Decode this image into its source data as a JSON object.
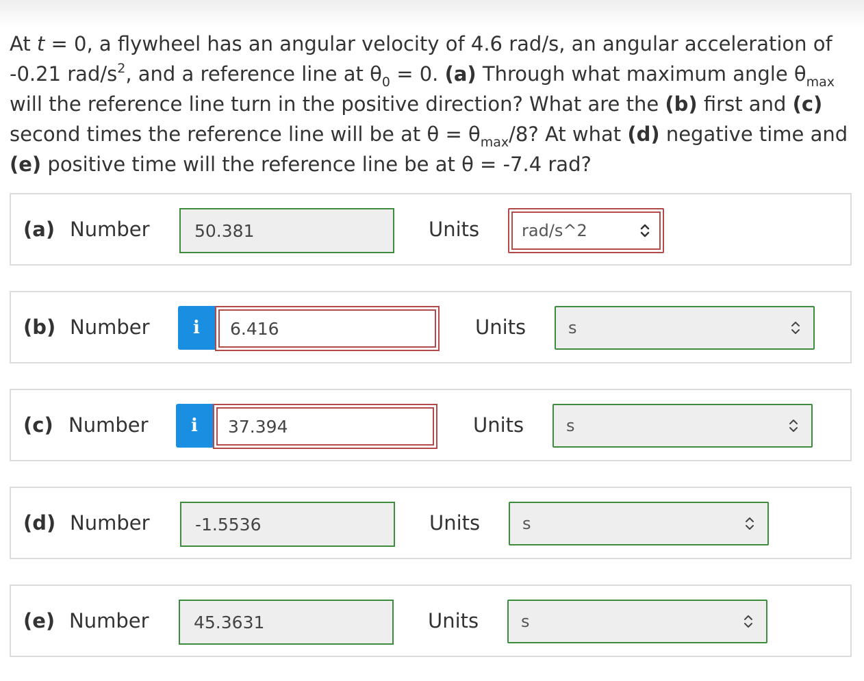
{
  "question": {
    "p1": "At ",
    "t": "t",
    "p2": " = 0, a flywheel has an angular velocity of 4.6 rad/s, an angular acceleration of -0.21 rad/s",
    "sq": "2",
    "p3": ", and a reference line at θ",
    "sub0": "0",
    "p4": " = 0. ",
    "a": "(a)",
    "p5": " Through what maximum angle θ",
    "submax1": "max",
    "p6": " will the reference line turn in the positive direction? What are the ",
    "b": "(b)",
    "p7": " first and ",
    "c": "(c)",
    "p8": " second times the reference line will be at θ = θ",
    "submax2": "max",
    "p9": "/8? At what ",
    "d": "(d)",
    "p10": " negative time and ",
    "e": "(e)",
    "p11": " positive time will the reference line be at θ = -7.4 rad?"
  },
  "answers": [
    {
      "letter": "(a)",
      "number_label": "Number",
      "value": "50.381",
      "units_label": "Units",
      "unit": "rad/s^2",
      "info": false
    },
    {
      "letter": "(b)",
      "number_label": "Number",
      "value": "6.416",
      "units_label": "Units",
      "unit": "s",
      "info": true,
      "info_glyph": "i"
    },
    {
      "letter": "(c)",
      "number_label": "Number",
      "value": "37.394",
      "units_label": "Units",
      "unit": "s",
      "info": true,
      "info_glyph": "i"
    },
    {
      "letter": "(d)",
      "number_label": "Number",
      "value": "-1.5536",
      "units_label": "Units",
      "unit": "s",
      "info": false
    },
    {
      "letter": "(e)",
      "number_label": "Number",
      "value": "45.3631",
      "units_label": "Units",
      "unit": "s",
      "info": false
    }
  ],
  "colors": {
    "correct_border": "#3d8b3d",
    "incorrect_border": "#b34a4a",
    "info_button": "#1a8ee0"
  },
  "icons": {
    "select": "chevron-up-down-icon",
    "info": "info-icon"
  }
}
